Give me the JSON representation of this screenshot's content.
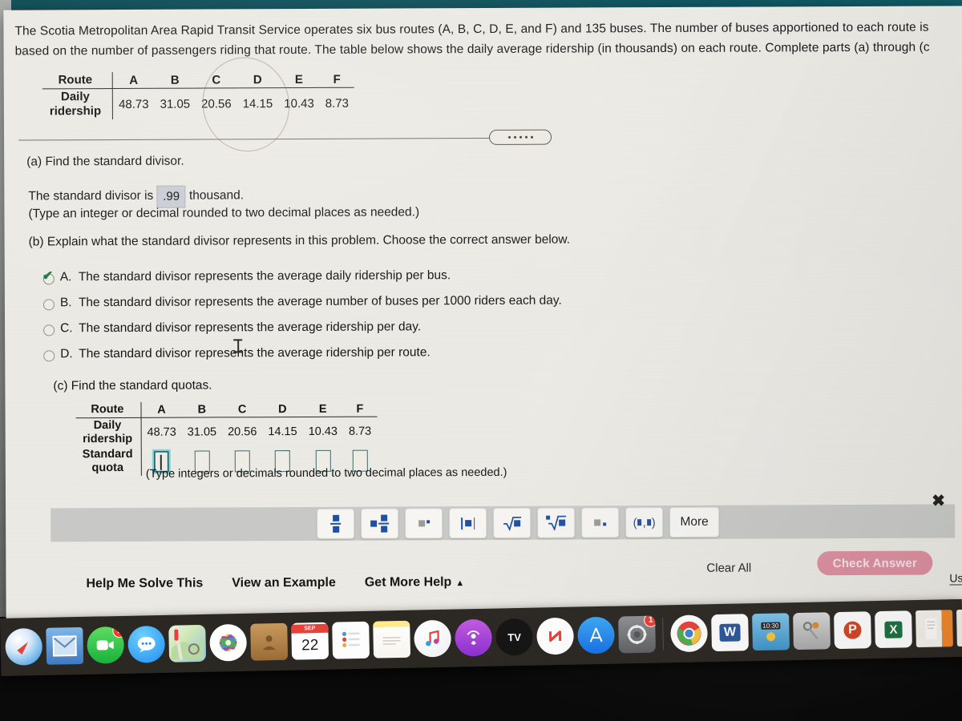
{
  "problem": {
    "stem_line1": "The Scotia Metropolitan Area Rapid Transit Service operates six bus routes (A, B, C, D, E, and F) and 135 buses. The number of buses apportioned to each route is",
    "stem_line2": "based on the number of passengers riding that route. The table below shows the daily average ridership (in thousands) on each route. Complete parts (a) through (c"
  },
  "table_top": {
    "row_header_1": "Route",
    "row_header_2_line1": "Daily",
    "row_header_2_line2": "ridership",
    "routes": [
      "A",
      "B",
      "C",
      "D",
      "E",
      "F"
    ],
    "ridership": [
      "48.73",
      "31.05",
      "20.56",
      "14.15",
      "10.43",
      "8.73"
    ]
  },
  "part_a": {
    "prompt": "(a) Find the standard divisor.",
    "sentence_before": "The standard divisor is",
    "answer_value": ".99",
    "sentence_after": "thousand.",
    "instruction": "(Type an integer or decimal rounded to two decimal places as needed.)"
  },
  "part_b": {
    "prompt": "(b) Explain what the standard divisor represents in this problem. Choose the correct answer below.",
    "choices": [
      {
        "letter": "A.",
        "text": "The standard divisor represents the average daily ridership per bus.",
        "selected": true
      },
      {
        "letter": "B.",
        "text": "The standard divisor represents the average number of buses per 1000 riders each day.",
        "selected": false
      },
      {
        "letter": "C.",
        "text": "The standard divisor represents the average ridership per day.",
        "selected": false
      },
      {
        "letter": "D.",
        "text": "The standard divisor represents the average ridership per route.",
        "selected": false
      }
    ]
  },
  "part_c": {
    "prompt": "(c) Find the standard quotas.",
    "row_header_1": "Route",
    "row_header_2_line1": "Daily",
    "row_header_2_line2": "ridership",
    "row_header_3_line1": "Standard",
    "row_header_3_line2": "quota",
    "routes": [
      "A",
      "B",
      "C",
      "D",
      "E",
      "F"
    ],
    "ridership": [
      "48.73",
      "31.05",
      "20.56",
      "14.15",
      "10.43",
      "8.73"
    ],
    "quota_inputs": [
      "",
      "",
      "",
      "",
      "",
      ""
    ],
    "active_input_index": 0,
    "instruction": "(Type integers or decimals rounded to two decimal places as needed.)"
  },
  "math_toolbar": {
    "buttons": [
      {
        "name": "fraction",
        "label": ""
      },
      {
        "name": "mixed-number",
        "label": ""
      },
      {
        "name": "exponent",
        "label": ""
      },
      {
        "name": "absolute-value",
        "label": ""
      },
      {
        "name": "square-root",
        "label": ""
      },
      {
        "name": "nth-root",
        "label": ""
      },
      {
        "name": "decimal-point",
        "label": ""
      },
      {
        "name": "ordered-pair",
        "label": ""
      },
      {
        "name": "more",
        "label": "More"
      }
    ],
    "more_label": "More"
  },
  "footer": {
    "help_me_solve_this": "Help Me Solve This",
    "view_an_example": "View an Example",
    "get_more_help": "Get More Help",
    "get_more_help_caret": "▲",
    "clear_all": "Clear All",
    "check_answer": "Check Answer",
    "contact_us_partial": "Us",
    "close_icon": "✖"
  },
  "colors": {
    "page_bg": "#eceae4",
    "check_answer_bg": "#dc8e9f",
    "answer_box_bg": "#c9ccd2",
    "input_border": "#3c6b6b",
    "focus_ring": "#8fd3da",
    "checkmark_green": "#1b7a3e",
    "toolbar_band": "#c8c9c6",
    "math_glyph_blue": "#1e4fa3",
    "desktop_teal": "#0f5560",
    "dock_bg": "#2b2723"
  },
  "dock": {
    "items": [
      {
        "name": "safari",
        "label": "Safari",
        "badge": ""
      },
      {
        "name": "mail",
        "label": "Mail",
        "badge": ""
      },
      {
        "name": "facetime",
        "label": "FaceTime",
        "badge": "1"
      },
      {
        "name": "messages",
        "label": "Messages",
        "badge": ""
      },
      {
        "name": "maps",
        "label": "Maps",
        "badge": ""
      },
      {
        "name": "photos",
        "label": "Photos",
        "badge": ""
      },
      {
        "name": "contacts",
        "label": "Contacts",
        "badge": ""
      },
      {
        "name": "calendar",
        "label": "Calendar",
        "badge": "",
        "cal_month": "SEP",
        "cal_day": "22"
      },
      {
        "name": "reminders",
        "label": "Reminders",
        "badge": ""
      },
      {
        "name": "notes",
        "label": "Notes",
        "badge": ""
      },
      {
        "name": "itunes",
        "label": "iTunes",
        "badge": ""
      },
      {
        "name": "podcasts",
        "label": "Podcasts",
        "badge": ""
      },
      {
        "name": "appletv",
        "label": "TV",
        "badge": ""
      },
      {
        "name": "news",
        "label": "News",
        "badge": ""
      },
      {
        "name": "app-store",
        "label": "App Store",
        "badge": ""
      },
      {
        "name": "system-preferences",
        "label": "System Preferences",
        "badge": "1"
      },
      {
        "name": "chrome",
        "label": "Google Chrome",
        "badge": ""
      },
      {
        "name": "word",
        "label": "Microsoft Word",
        "badge": "",
        "glyph": "W"
      },
      {
        "name": "weather-widget",
        "label": "Widget",
        "badge": "",
        "time": "10:30"
      },
      {
        "name": "keychain-access",
        "label": "Keychain Access",
        "badge": ""
      },
      {
        "name": "powerpoint",
        "label": "Microsoft PowerPoint",
        "badge": "",
        "glyph": "P"
      },
      {
        "name": "excel",
        "label": "Microsoft Excel",
        "badge": "",
        "glyph": "X"
      },
      {
        "name": "document-1",
        "label": "Document",
        "badge": ""
      },
      {
        "name": "document-2",
        "label": "Document",
        "badge": ""
      }
    ]
  }
}
